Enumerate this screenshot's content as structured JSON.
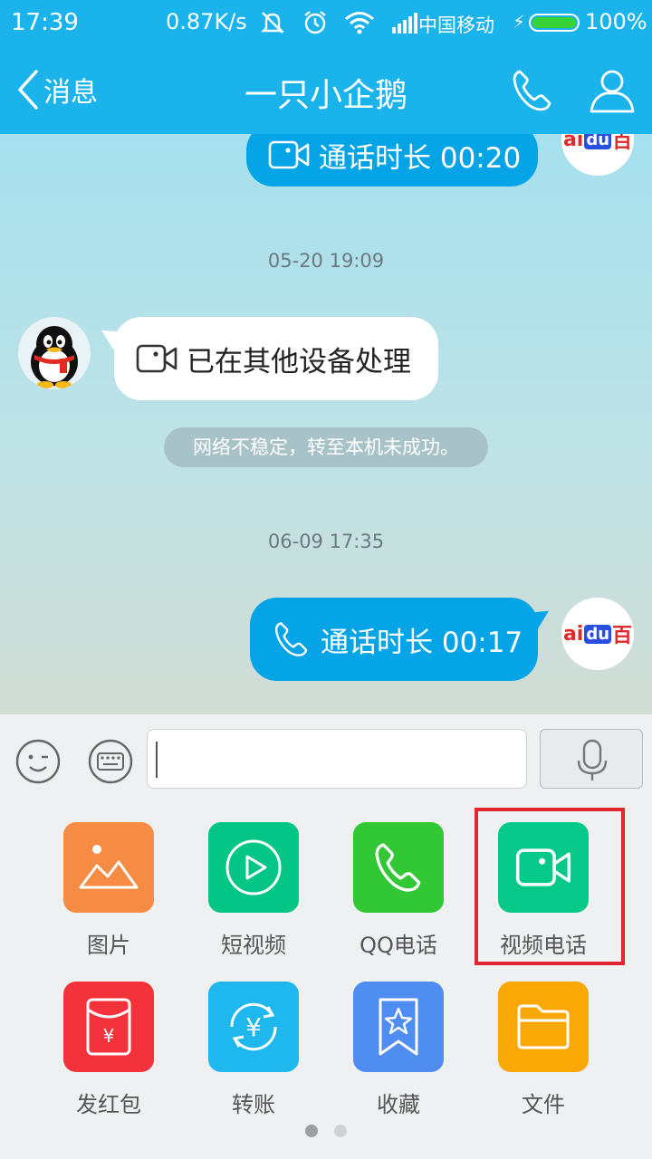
{
  "status_bar": {
    "time": "17:39",
    "speed": "0.87K/s",
    "carrier": "中国移动",
    "battery": "100%",
    "battery_level": 1.0,
    "icons": [
      "mute-icon",
      "alarm-icon",
      "wifi-icon",
      "signal-icon",
      "charging-icon"
    ]
  },
  "nav": {
    "back_label": "消息",
    "title": "一只小企鹅",
    "call_icon": "phone-icon",
    "profile_icon": "profile-icon"
  },
  "messages": [
    {
      "type": "outgoing",
      "icon": "video-call-icon",
      "text": "通话时长 00:20",
      "avatar": "baidu-avatar"
    },
    {
      "type": "timestamp",
      "text": "05-20 19:09"
    },
    {
      "type": "incoming",
      "icon": "video-call-icon",
      "text": "已在其他设备处理",
      "avatar": "qq-penguin-avatar"
    },
    {
      "type": "system",
      "text": "网络不稳定，转至本机未成功。"
    },
    {
      "type": "timestamp",
      "text": "06-09 17:35"
    },
    {
      "type": "outgoing",
      "icon": "phone-icon",
      "text": "通话时长 00:17",
      "avatar": "baidu-avatar"
    }
  ],
  "baidu_logo": {
    "ai": "ai",
    "du": "du",
    "bai": "百"
  },
  "input": {
    "value": "",
    "placeholder": ""
  },
  "panel": {
    "tiles": [
      {
        "label": "图片",
        "icon": "image-icon",
        "color": "#f68b43"
      },
      {
        "label": "短视频",
        "icon": "play-icon",
        "color": "#03c686"
      },
      {
        "label": "QQ电话",
        "icon": "phone-icon",
        "color": "#32c735"
      },
      {
        "label": "视频电话",
        "icon": "video-call-icon",
        "color": "#06c889",
        "highlighted": true
      },
      {
        "label": "发红包",
        "icon": "red-packet-icon",
        "color": "#f4323c"
      },
      {
        "label": "转账",
        "icon": "transfer-icon",
        "color": "#1fb8ee"
      },
      {
        "label": "收藏",
        "icon": "favorites-icon",
        "color": "#4f8ef0"
      },
      {
        "label": "文件",
        "icon": "folder-icon",
        "color": "#f9a806"
      }
    ],
    "page_count": 2,
    "current_page": 1
  },
  "colors": {
    "accent": "#1bb3ec",
    "outgoing_bubble": "#05a4e6",
    "highlight": "#e0282e"
  }
}
